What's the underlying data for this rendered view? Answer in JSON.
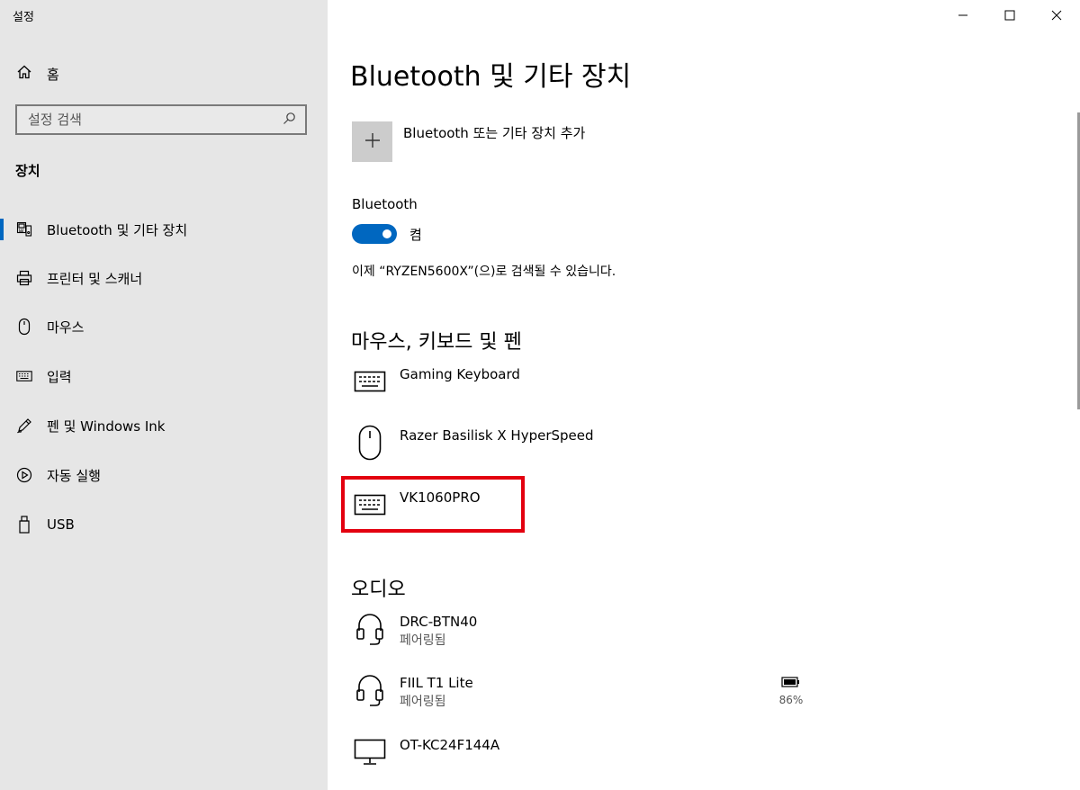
{
  "window": {
    "title": "설정"
  },
  "sidebar": {
    "home_label": "홈",
    "search_placeholder": "설정 검색",
    "section_label": "장치",
    "items": [
      {
        "label": "Bluetooth 및 기타 장치",
        "icon": "bluetooth-devices-icon",
        "active": true
      },
      {
        "label": "프린터 및 스캐너",
        "icon": "printer-icon",
        "active": false
      },
      {
        "label": "마우스",
        "icon": "mouse-icon",
        "active": false
      },
      {
        "label": "입력",
        "icon": "keyboard-icon",
        "active": false
      },
      {
        "label": "펜 및 Windows Ink",
        "icon": "pen-icon",
        "active": false
      },
      {
        "label": "자동 실행",
        "icon": "autoplay-icon",
        "active": false
      },
      {
        "label": "USB",
        "icon": "usb-icon",
        "active": false
      }
    ]
  },
  "main": {
    "title": "Bluetooth 및 기타 장치",
    "add_device_label": "Bluetooth 또는 기타 장치 추가",
    "bluetooth_label": "Bluetooth",
    "bluetooth_state": "켬",
    "discoverable_text": "이제 “RYZEN5600X”(으)로 검색될 수 있습니다.",
    "groups": [
      {
        "title": "마우스, 키보드 및 펜",
        "devices": [
          {
            "name": "Gaming Keyboard",
            "icon": "keyboard-icon",
            "status": ""
          },
          {
            "name": "Razer Basilisk X HyperSpeed",
            "icon": "mouse-icon",
            "status": ""
          },
          {
            "name": "VK1060PRO",
            "icon": "keyboard-icon",
            "status": ""
          }
        ]
      },
      {
        "title": "오디오",
        "devices": [
          {
            "name": "DRC-BTN40",
            "icon": "headset-icon",
            "status": "페어링됨"
          },
          {
            "name": "FIIL T1 Lite",
            "icon": "headset-icon",
            "status": "페어링됨",
            "battery": "86%"
          },
          {
            "name": "OT-KC24F144A",
            "icon": "monitor-icon",
            "status": ""
          }
        ]
      }
    ]
  },
  "colors": {
    "accent": "#0067c0",
    "highlight": "#e3000f",
    "sidebar_bg": "#e6e6e6"
  }
}
